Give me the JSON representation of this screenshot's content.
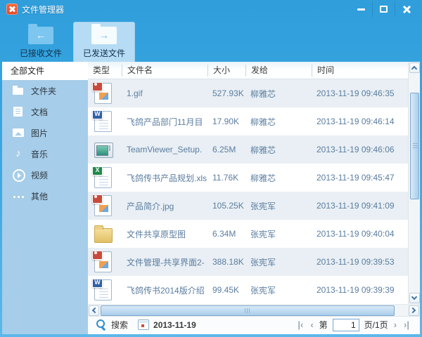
{
  "window": {
    "title": "文件管理器"
  },
  "toolbar": {
    "buttons": [
      {
        "label": "已接收文件",
        "icon": "folder-receive-icon",
        "active": false
      },
      {
        "label": "已发送文件",
        "icon": "folder-send-icon",
        "active": true
      }
    ]
  },
  "sidebar": {
    "all_files_label": "全部文件",
    "items": [
      {
        "label": "文件夹",
        "icon": "folder-icon"
      },
      {
        "label": "文档",
        "icon": "document-icon"
      },
      {
        "label": "图片",
        "icon": "picture-icon"
      },
      {
        "label": "音乐",
        "icon": "music-icon"
      },
      {
        "label": "视频",
        "icon": "video-icon"
      },
      {
        "label": "其他",
        "icon": "ellipsis-icon"
      }
    ]
  },
  "table": {
    "headers": [
      "类型",
      "文件名",
      "大小",
      "发给",
      "时间"
    ],
    "rows": [
      {
        "icon": "image-file-icon",
        "name": "1.gif",
        "size": "527.93K",
        "recipient": "柳雅芯",
        "time": "2013-11-19 09:46:35"
      },
      {
        "icon": "word-file-icon",
        "name": "飞鸽产品部门11月目",
        "size": "17.90K",
        "recipient": "柳雅芯",
        "time": "2013-11-19 09:46:14"
      },
      {
        "icon": "app-file-icon",
        "name": "TeamViewer_Setup.",
        "size": "6.25M",
        "recipient": "柳雅芯",
        "time": "2013-11-19 09:46:06"
      },
      {
        "icon": "excel-file-icon",
        "name": "飞鸽传书产品规划.xls",
        "size": "11.76K",
        "recipient": "柳雅芯",
        "time": "2013-11-19 09:45:47"
      },
      {
        "icon": "image-file-icon",
        "name": "产品简介.jpg",
        "size": "105.25K",
        "recipient": "张宪军",
        "time": "2013-11-19 09:41:09"
      },
      {
        "icon": "folder-icon",
        "name": "文件共享原型图",
        "size": "6.34M",
        "recipient": "张宪军",
        "time": "2013-11-19 09:40:04"
      },
      {
        "icon": "image-file-icon",
        "name": "文件管理-共享界面2-",
        "size": "388.18K",
        "recipient": "张宪军",
        "time": "2013-11-19 09:39:53"
      },
      {
        "icon": "word-file-icon",
        "name": "飞鸽传书2014版介绍",
        "size": "99.45K",
        "recipient": "张宪军",
        "time": "2013-11-19 09:39:39"
      }
    ]
  },
  "footer": {
    "search_label": "搜索",
    "date_value": "2013-11-19",
    "pager": {
      "first": "|‹",
      "prev": "‹",
      "label_prefix": "第",
      "value": "1",
      "label_suffix": "页/1页",
      "next": "›",
      "last": "›|"
    }
  },
  "colors": {
    "accent_blue": "#37a4e0",
    "sidebar_blue": "#a6cde9",
    "active_button_bg": "#b5dcf4",
    "row_stripe": "#e9eff4",
    "row_text": "#5b7da0",
    "logo_orange": "#ee5530"
  }
}
